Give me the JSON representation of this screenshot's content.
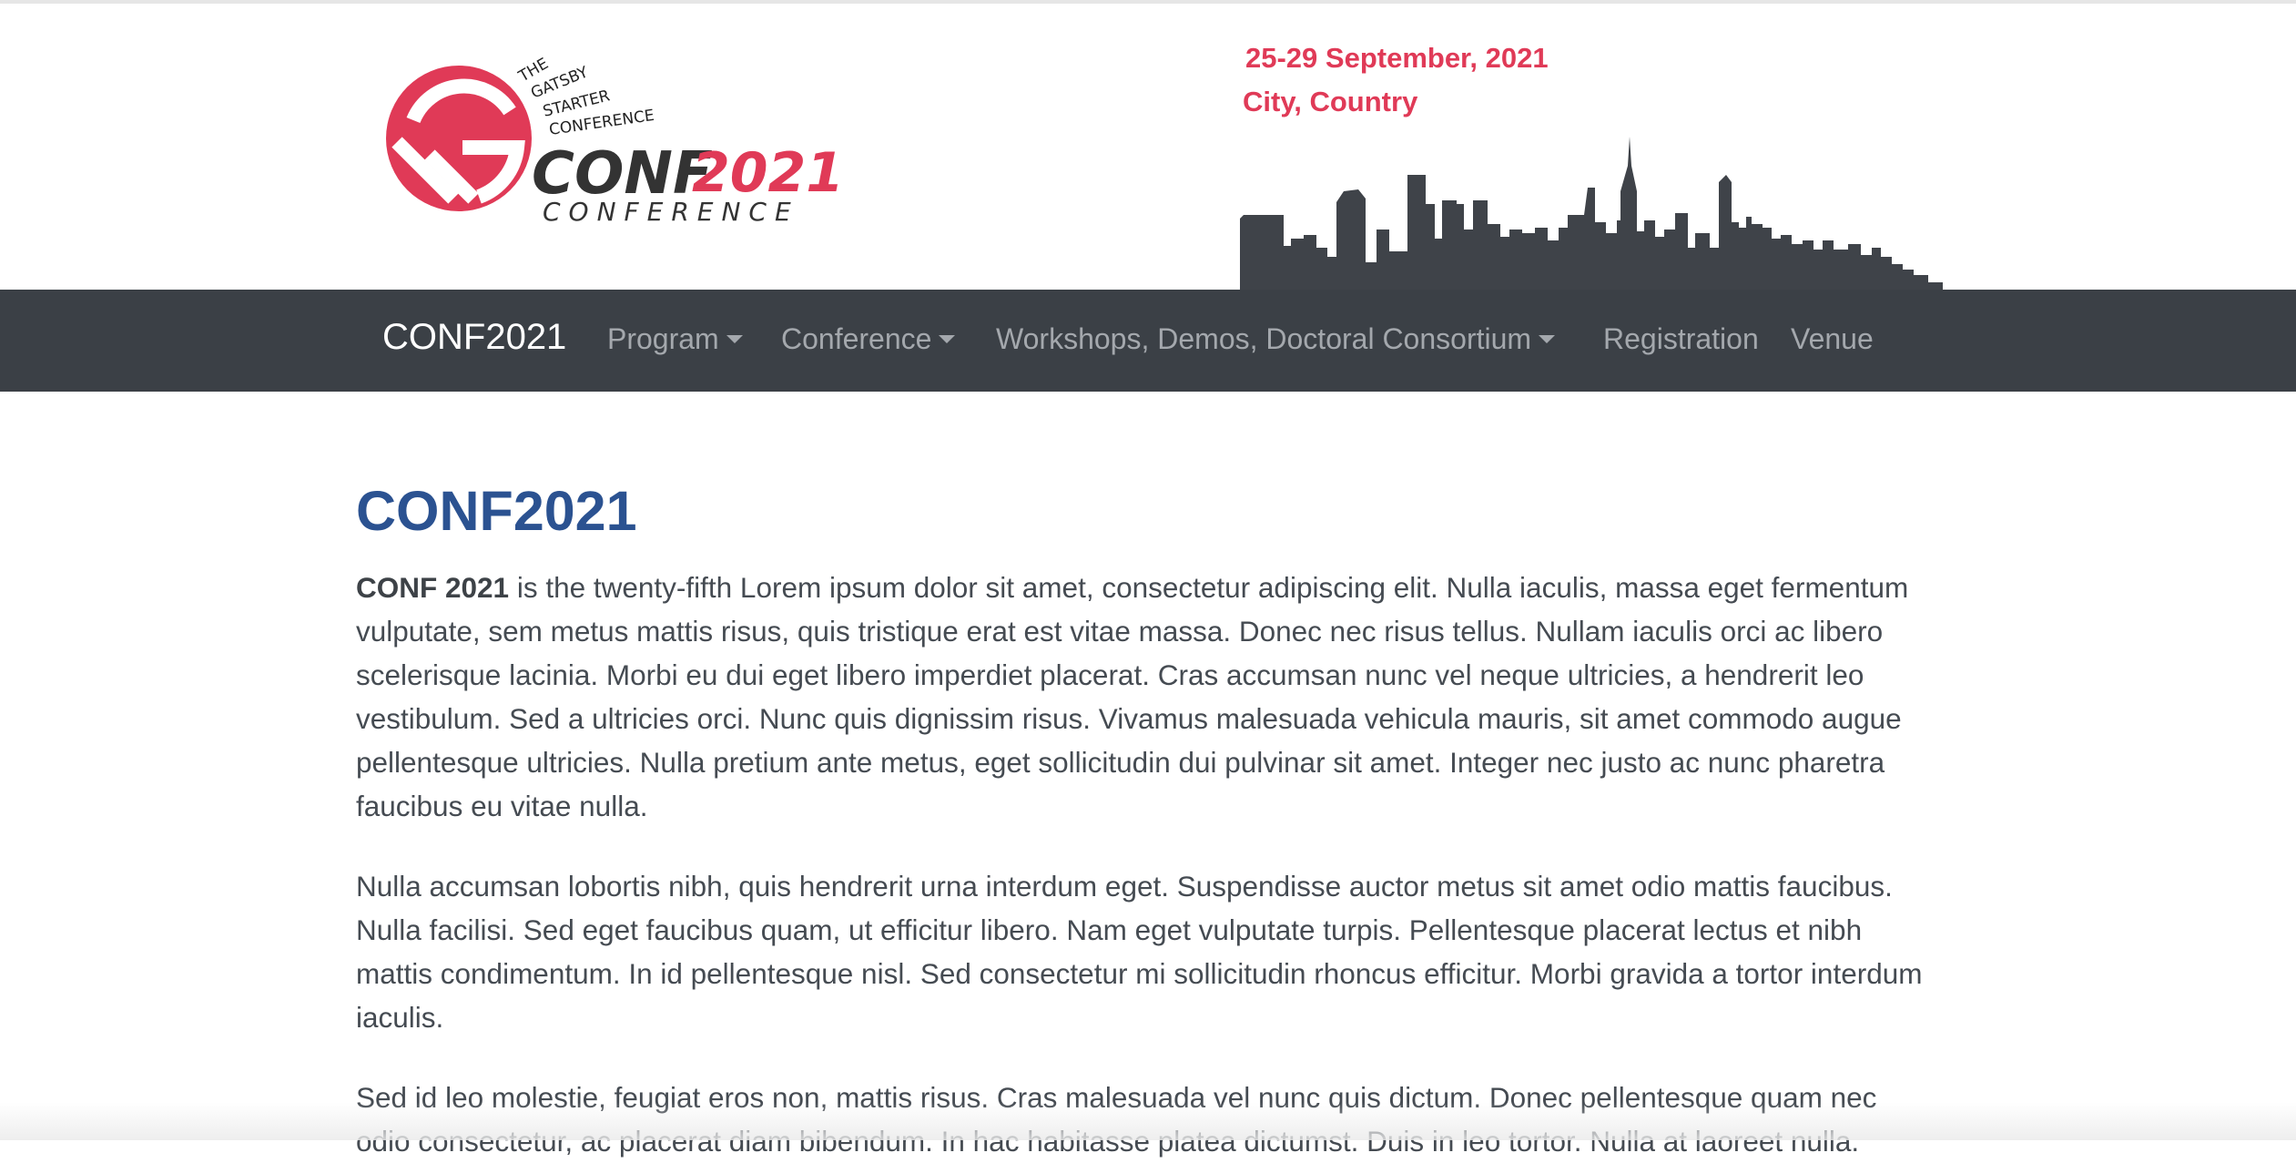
{
  "header": {
    "logo": {
      "tagline_lines": [
        "THE",
        "GATSBY",
        "STARTER",
        "CONFERENCE"
      ],
      "conf_text": "CONF",
      "year_text": "2021",
      "sub_text": "CONFERENCE"
    },
    "date": "25-29 September, 2021",
    "location": "City, Country"
  },
  "nav": {
    "brand": "CONF2021",
    "items": [
      {
        "label": "Program",
        "dropdown": true
      },
      {
        "label": "Conference",
        "dropdown": true
      },
      {
        "label": "Workshops, Demos, Doctoral Consortium",
        "dropdown": true
      },
      {
        "label": "Registration",
        "dropdown": false
      },
      {
        "label": "Venue",
        "dropdown": false
      }
    ]
  },
  "main": {
    "title": "CONF2021",
    "paragraphs": [
      {
        "lead": "CONF 2021",
        "text": " is the twenty-fifth Lorem ipsum dolor sit amet, consectetur adipiscing elit. Nulla iaculis, massa eget fermentum vulputate, sem metus mattis risus, quis tristique erat est vitae massa. Donec nec risus tellus. Nullam iaculis orci ac libero scelerisque lacinia. Morbi eu dui eget libero imperdiet placerat. Cras accumsan nunc vel neque ultricies, a hendrerit leo vestibulum. Sed a ultricies orci. Nunc quis dignissim risus. Vivamus malesuada vehicula mauris, sit amet commodo augue pellentesque ultricies. Nulla pretium ante metus, eget sollicitudin dui pulvinar sit amet. Integer nec justo ac nunc pharetra faucibus eu vitae nulla."
      },
      {
        "text": "Nulla accumsan lobortis nibh, quis hendrerit urna interdum eget. Suspendisse auctor metus sit amet odio mattis faucibus. Nulla facilisi. Sed eget faucibus quam, ut efficitur libero. Nam eget vulputate turpis. Pellentesque placerat lectus et nibh mattis condimentum. In id pellentesque nisl. Sed consectetur mi sollicitudin rhoncus efficitur. Morbi gravida a tortor interdum iaculis."
      },
      {
        "text": "Sed id leo molestie, feugiat eros non, mattis risus. Cras malesuada vel nunc quis dictum. Donec pellentesque quam nec odio consectetur, ac placerat diam bibendum. In hac habitasse platea dictumst. Duis in leo tortor. Nulla at laoreet nulla."
      }
    ]
  },
  "colors": {
    "brand_red": "#e03a57",
    "title_blue": "#2b5291",
    "navbar_bg": "#3b4046",
    "nav_text": "#a4a8ad",
    "skyline": "#3f4349"
  },
  "icons": {
    "logo": "gatsby-logo-icon",
    "skyline": "city-skyline-icon",
    "caret": "caret-down-icon"
  }
}
